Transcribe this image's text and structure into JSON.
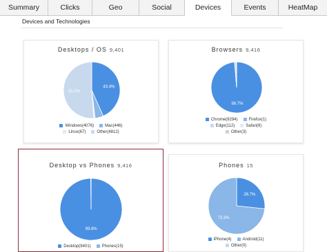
{
  "tabs": [
    {
      "label": "Summary",
      "active": false
    },
    {
      "label": "Clicks",
      "active": false
    },
    {
      "label": "Geo",
      "active": false
    },
    {
      "label": "Social",
      "active": false
    },
    {
      "label": "Devices",
      "active": true
    },
    {
      "label": "Events",
      "active": false
    },
    {
      "label": "HeatMap",
      "active": false
    }
  ],
  "section": {
    "title": "Devices and Technologies"
  },
  "colors": {
    "dark_blue": "#4a90e2",
    "light_blue": "#c8d9ee",
    "mid_blue": "#8ab6e8",
    "selected_border": "#8a2a3a"
  },
  "cards": [
    {
      "id": "desktops-os",
      "title": "Desktops / OS",
      "count": "9,401",
      "selected": false,
      "chart_data": {
        "type": "pie",
        "labels": [
          "Windows",
          "Mac",
          "Linux",
          "Other"
        ],
        "values": [
          4076,
          446,
          67,
          4812
        ],
        "colors": [
          "#4a90e2",
          "#8ab6e8",
          "#e2eaf5",
          "#c8d9ee"
        ],
        "slice_labels": [
          "43.4%",
          "",
          "",
          "51.2%"
        ]
      },
      "legend": [
        [
          "Windows(4076)",
          "Mac(446)"
        ],
        [
          "Linux(67)",
          "Other(4812)"
        ]
      ]
    },
    {
      "id": "browsers",
      "title": "Browsers",
      "count": "9,416",
      "selected": false,
      "chart_data": {
        "type": "pie",
        "labels": [
          "Chrome",
          "Firefox",
          "Edge",
          "Safari",
          "Other"
        ],
        "values": [
          9294,
          1,
          112,
          6,
          3
        ],
        "colors": [
          "#4a90e2",
          "#8ab6e8",
          "#c8d9ee",
          "#e2eaf5",
          "#d0d0d0"
        ],
        "slice_labels": [
          "98.7%",
          "",
          "",
          "",
          ""
        ]
      },
      "legend": [
        [
          "Chrome(9294)",
          "Firefox(1)"
        ],
        [
          "Edge(112)",
          "Safari(6)"
        ],
        [
          "Other(3)"
        ]
      ]
    },
    {
      "id": "desktop-vs-phones",
      "title": "Desktop vs Phones",
      "count": "9,416",
      "selected": true,
      "chart_data": {
        "type": "pie",
        "labels": [
          "Desktop",
          "Phones"
        ],
        "values": [
          9401,
          15
        ],
        "colors": [
          "#4a90e2",
          "#8ab6e8"
        ],
        "slice_labels": [
          "99.8%",
          ""
        ]
      },
      "legend": [
        [
          "Desktop(9401)",
          "Phones(15)"
        ]
      ]
    },
    {
      "id": "phones",
      "title": "Phones",
      "count": "15",
      "selected": false,
      "chart_data": {
        "type": "pie",
        "labels": [
          "iPhone",
          "Android",
          "Other"
        ],
        "values": [
          4,
          11,
          0
        ],
        "colors": [
          "#4a90e2",
          "#8ab6e8",
          "#c8d9ee"
        ],
        "slice_labels": [
          "26.7%",
          "73.3%",
          ""
        ]
      },
      "legend": [
        [
          "iPhone(4)",
          "Android(11)"
        ],
        [
          "Other(0)"
        ]
      ]
    }
  ]
}
